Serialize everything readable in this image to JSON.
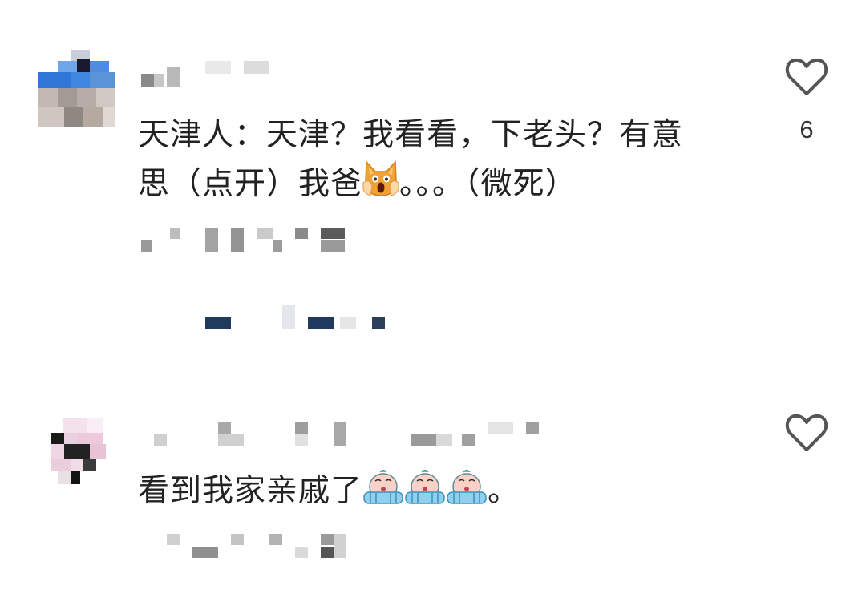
{
  "comments": [
    {
      "text_line1": "天津人：天津？我看看，下老头？有意",
      "text_line2_before_emoji": "思（点开）我爸",
      "text_line2_after_emoji": "。。。（微死）",
      "emoji": "screaming-cat-emoji",
      "like_count": "6"
    },
    {
      "text_before_emoji": "看到我家亲戚了",
      "text_after_emoji": "。",
      "emoji": "crying-face-emoji",
      "emoji_repeat": 3
    }
  ],
  "icons": {
    "like": "heart-outline-icon"
  },
  "colors": {
    "text": "#222222",
    "heart_stroke": "#555555",
    "blur_blue": "#1f3a5c"
  }
}
